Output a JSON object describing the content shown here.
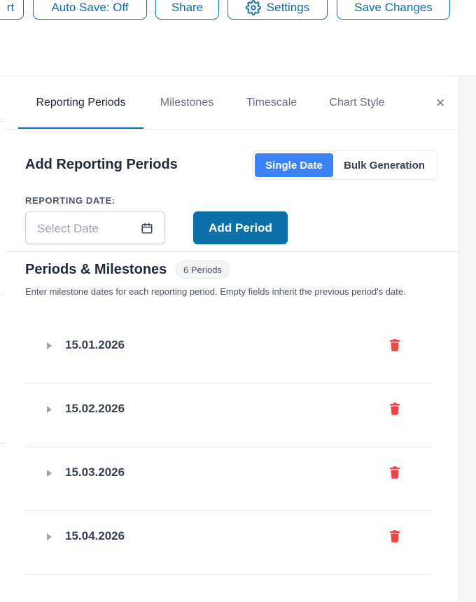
{
  "toolbar": {
    "export_label": "rt",
    "autosave_label": "Auto Save: Off",
    "share_label": "Share",
    "settings_label": "Settings",
    "save_label": "Save Changes"
  },
  "tabs": [
    {
      "label": "Reporting Periods",
      "active": true
    },
    {
      "label": "Milestones",
      "active": false
    },
    {
      "label": "Timescale",
      "active": false
    },
    {
      "label": "Chart Style",
      "active": false
    }
  ],
  "close_icon": "close-icon",
  "add_section": {
    "title": "Add Reporting Periods",
    "mode_single": "Single Date",
    "mode_bulk": "Bulk Generation",
    "date_label": "REPORTING DATE:",
    "date_placeholder": "Select Date",
    "date_value": "",
    "add_button": "Add Period"
  },
  "periods_section": {
    "title": "Periods & Milestones",
    "count_badge": "6 Periods",
    "hint": "Enter milestone dates for each reporting period. Empty fields inherit the previous period's date."
  },
  "periods": [
    {
      "date": "15.01.2026"
    },
    {
      "date": "15.02.2026"
    },
    {
      "date": "15.03.2026"
    },
    {
      "date": "15.04.2026"
    }
  ],
  "colors": {
    "accent": "#0b6fa8",
    "segment_active": "#3b82f6",
    "delete": "#ef4444"
  }
}
